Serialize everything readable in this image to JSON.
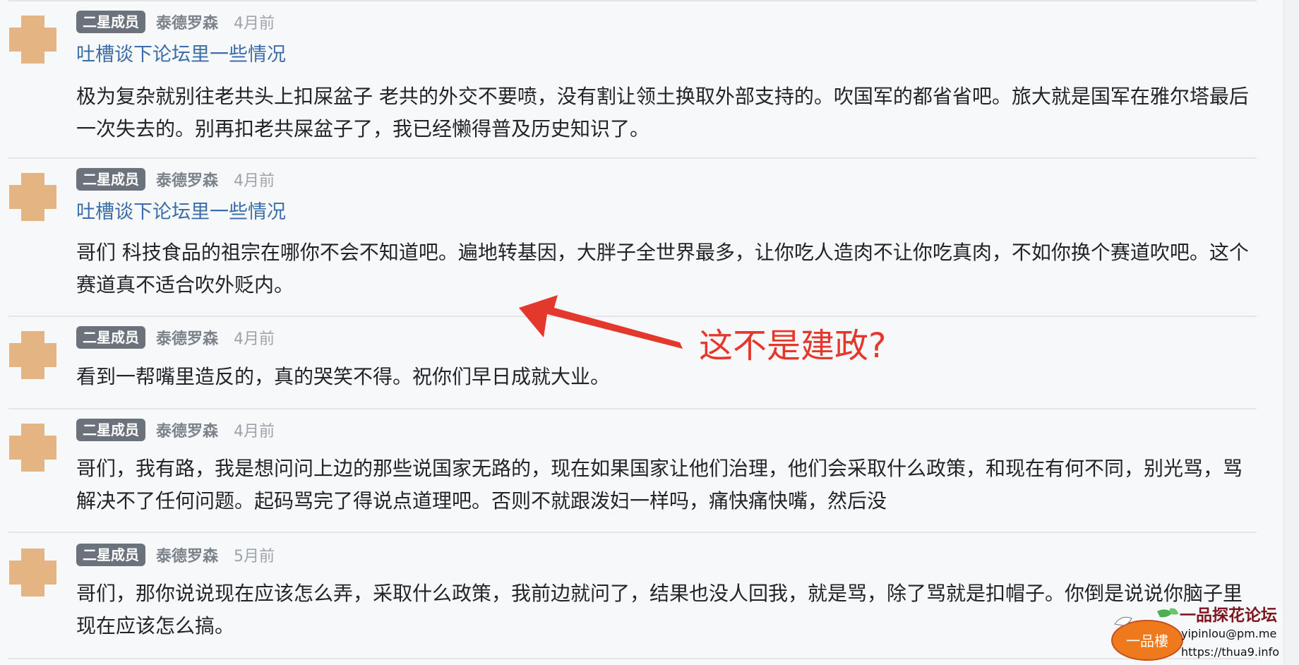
{
  "posts": [
    {
      "badge": "二星成员",
      "author": "泰德罗森",
      "time": "4月前",
      "topic": "吐槽谈下论坛里一些情况",
      "text": "极为复杂就别往老共头上扣屎盆子 老共的外交不要喷，没有割让领土换取外部支持的。吹国军的都省省吧。旅大就是国军在雅尔塔最后一次失去的。别再扣老共屎盆子了，我已经懒得普及历史知识了。"
    },
    {
      "badge": "二星成员",
      "author": "泰德罗森",
      "time": "4月前",
      "topic": "吐槽谈下论坛里一些情况",
      "text": "哥们 科技食品的祖宗在哪你不会不知道吧。遍地转基因，大胖子全世界最多，让你吃人造肉不让你吃真肉，不如你换个赛道吹吧。这个赛道真不适合吹外贬内。"
    },
    {
      "badge": "二星成员",
      "author": "泰德罗森",
      "time": "4月前",
      "text": "看到一帮嘴里造反的，真的哭笑不得。祝你们早日成就大业。"
    },
    {
      "badge": "二星成员",
      "author": "泰德罗森",
      "time": "4月前",
      "text": "哥们，我有路，我是想问问上边的那些说国家无路的，现在如果国家让他们治理，他们会采取什么政策，和现在有何不同，别光骂，骂解决不了任何问题。起码骂完了得说点道理吧。否则不就跟泼妇一样吗，痛快痛快嘴，然后没"
    },
    {
      "badge": "二星成员",
      "author": "泰德罗森",
      "time": "5月前",
      "text": "哥们，那你说说现在应该怎么弄，采取什么政策，我前边就问了，结果也没人回我，就是骂，除了骂就是扣帽子。你倒是说说你脑子里现在应该怎么搞。"
    }
  ],
  "annotation": {
    "text": "这不是建政?",
    "color": "#e5382c"
  },
  "watermark": {
    "logo_text": "一品樓",
    "title": "一品探花论坛",
    "email": "yipinlou@pm.me",
    "url": "https://thua9.info"
  },
  "colors": {
    "avatar": "#e5b483",
    "badge": "#6b727c",
    "topic_link": "#3b6ea8",
    "background": "#f7f8fa"
  }
}
